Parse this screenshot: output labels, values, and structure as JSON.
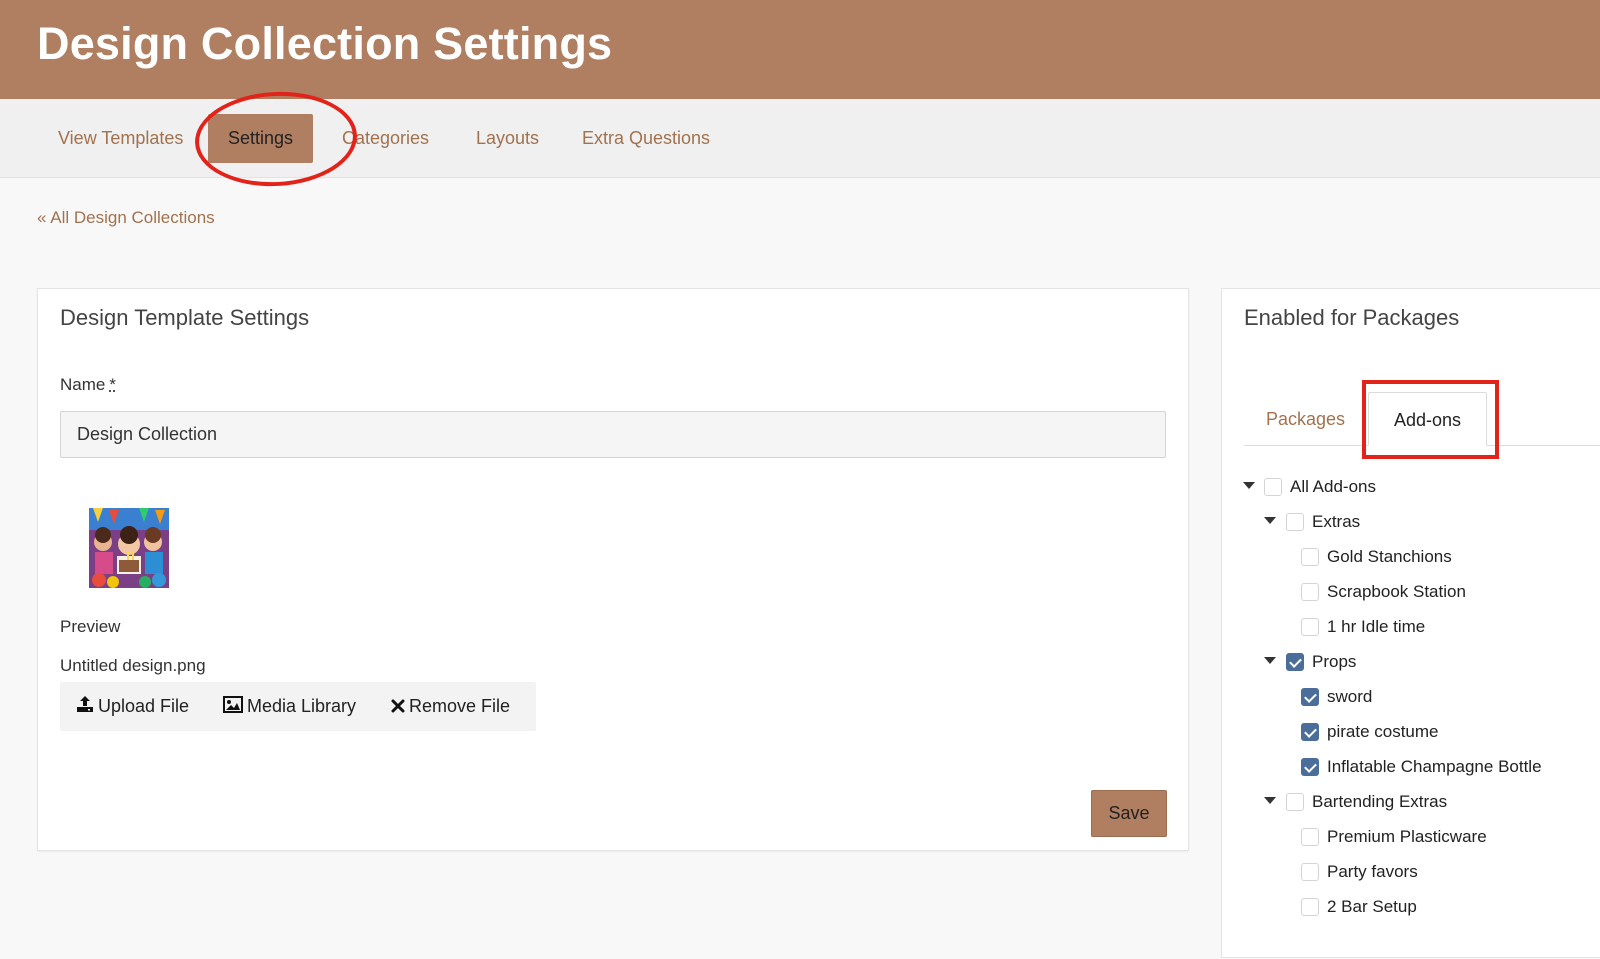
{
  "header": {
    "title": "Design Collection Settings"
  },
  "nav": {
    "items": [
      {
        "label": "View Templates"
      },
      {
        "label": "Settings"
      },
      {
        "label": "Categories"
      },
      {
        "label": "Layouts"
      },
      {
        "label": "Extra Questions"
      }
    ],
    "active": "Settings"
  },
  "breadcrumb": {
    "back_label": "« All Design Collections"
  },
  "template_settings": {
    "title": "Design Template Settings",
    "name_label": "Name",
    "required_mark": "*",
    "name_value": "Design Collection",
    "preview_label": "Preview",
    "file_name": "Untitled design.png",
    "actions": {
      "upload": "Upload File",
      "media": "Media Library",
      "remove": "Remove File"
    },
    "save_label": "Save"
  },
  "packages_panel": {
    "title": "Enabled for Packages",
    "tabs": [
      {
        "label": "Packages"
      },
      {
        "label": "Add-ons"
      }
    ],
    "active_tab": "Add-ons",
    "tree": [
      {
        "label": "All Add-ons",
        "level": 0,
        "expandable": true,
        "checked": false
      },
      {
        "label": "Extras",
        "level": 1,
        "expandable": true,
        "checked": false
      },
      {
        "label": "Gold Stanchions",
        "level": 2,
        "expandable": false,
        "checked": false
      },
      {
        "label": "Scrapbook Station",
        "level": 2,
        "expandable": false,
        "checked": false
      },
      {
        "label": "1 hr Idle time",
        "level": 2,
        "expandable": false,
        "checked": false
      },
      {
        "label": "Props",
        "level": 1,
        "expandable": true,
        "checked": true
      },
      {
        "label": "sword",
        "level": 2,
        "expandable": false,
        "checked": true
      },
      {
        "label": "pirate costume",
        "level": 2,
        "expandable": false,
        "checked": true
      },
      {
        "label": "Inflatable Champagne Bottle",
        "level": 2,
        "expandable": false,
        "checked": true
      },
      {
        "label": "Bartending Extras",
        "level": 1,
        "expandable": true,
        "checked": false
      },
      {
        "label": "Premium Plasticware",
        "level": 2,
        "expandable": false,
        "checked": false
      },
      {
        "label": "Party favors",
        "level": 2,
        "expandable": false,
        "checked": false
      },
      {
        "label": "2 Bar Setup",
        "level": 2,
        "expandable": false,
        "checked": false
      }
    ]
  },
  "colors": {
    "brand": "#b07e60",
    "link": "#a2724f",
    "checkbox_checked": "#4a6d9a",
    "annotation": "#e2231a"
  },
  "icons": {
    "upload": "upload-icon",
    "media": "image-icon",
    "remove": "x-icon",
    "expand": "caret-down-icon"
  }
}
